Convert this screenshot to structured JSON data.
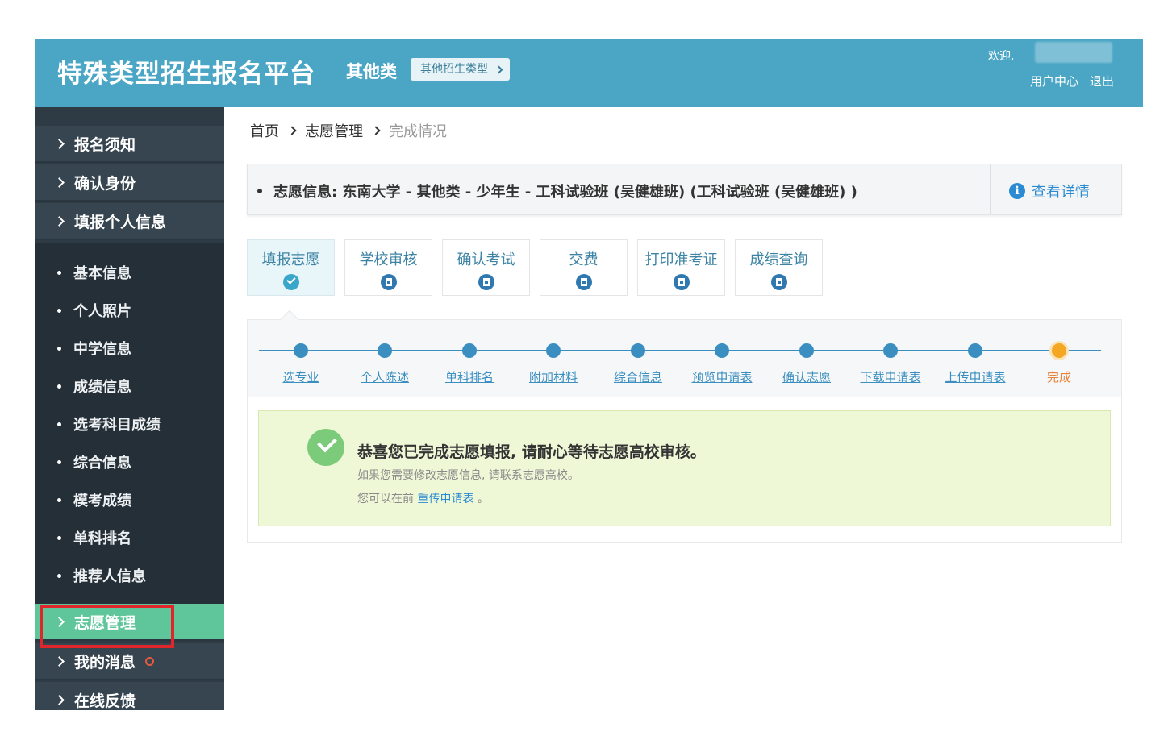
{
  "header": {
    "title": "特殊类型招生报名平台",
    "category": "其他类",
    "type_button": "其他招生类型",
    "welcome": "欢迎,",
    "user_center": "用户中心",
    "logout": "退出"
  },
  "sidebar": {
    "top_items": [
      "报名须知",
      "确认身份",
      "填报个人信息"
    ],
    "sub_items": [
      "基本信息",
      "个人照片",
      "中学信息",
      "成绩信息",
      "选考科目成绩",
      "综合信息",
      "模考成绩",
      "单科排名",
      "推荐人信息"
    ],
    "bottom_items": [
      "志愿管理",
      "我的消息",
      "在线反馈"
    ]
  },
  "breadcrumb": {
    "home": "首页",
    "section": "志愿管理",
    "current": "完成情况"
  },
  "info_bar": {
    "text": "志愿信息:  东南大学 - 其他类 - 少年生 - 工科试验班 (吴健雄班) (工科试验班 (吴健雄班) )",
    "detail_link": "查看详情",
    "info_icon_glyph": "i"
  },
  "step_tabs": [
    "填报志愿",
    "学校审核",
    "确认考试",
    "交费",
    "打印准考证",
    "成绩查询"
  ],
  "progress_steps": [
    "选专业",
    "个人陈述",
    "单科排名",
    "附加材料",
    "综合信息",
    "预览申请表",
    "确认志愿",
    "下载申请表",
    "上传申请表",
    "完成"
  ],
  "success": {
    "title": "恭喜您已完成志愿填报, 请耐心等待志愿高校审核。",
    "line1": "如果您需要修改志愿信息, 请联系志愿高校。",
    "line2_prefix": "您可以在前",
    "line2_link": "重传申请表",
    "line2_suffix": "。"
  },
  "colors": {
    "header_bg": "#4aa6c4",
    "sidebar_bg": "#36454f",
    "active_item": "#5ec69a",
    "highlight_border": "#e0262b",
    "link": "#2a8bd2",
    "done_node": "#f5a623"
  }
}
